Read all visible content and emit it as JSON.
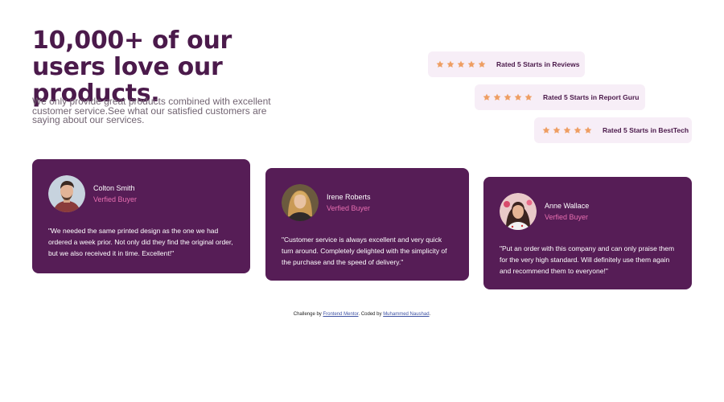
{
  "hero": {
    "title": "10,000+ of our users love our products.",
    "description": "We only provide great products combined with excellent customer service.See what our satisfied customers are saying about our services."
  },
  "ratings": [
    {
      "stars": 5,
      "label": "Rated 5 Starts in Reviews"
    },
    {
      "stars": 5,
      "label": "Rated 5 Starts in Report Guru"
    },
    {
      "stars": 5,
      "label": "Rated 5 Starts in BestTech"
    }
  ],
  "testimonials": [
    {
      "name": "Colton Smith",
      "role": "Verfied Buyer",
      "avatar_icon": "avatar-man-icon",
      "quote": "\"We needed the same printed design as the one we had ordered a week prior. Not only did they find the original order, but we also received it in time. Excellent!\""
    },
    {
      "name": "Irene Roberts",
      "role": "Verfied Buyer",
      "avatar_icon": "avatar-woman-icon",
      "quote": "\"Customer service is always excellent and very quick turn around. Completely delighted with the simplicity of the purchase and the speed of delivery.\""
    },
    {
      "name": "Anne Wallace",
      "role": "Verfied Buyer",
      "avatar_icon": "avatar-woman-icon",
      "quote": "\"Put an order with this company and can only praise them for the very high standard. Will definitely use them again and recommend them to everyone!\""
    }
  ],
  "footer": {
    "prefix": "Challenge by ",
    "link1": "Frontend Mentor",
    "middle": ". Coded by ",
    "link2": "Muhammed Naushad",
    "suffix": "."
  },
  "colors": {
    "primary": "#4b1a4b",
    "card_bg": "#561d56",
    "accent_pink": "#e76eb0",
    "star": "#ee9e63",
    "rating_bg": "#f7eef7",
    "muted_text": "#726472"
  }
}
